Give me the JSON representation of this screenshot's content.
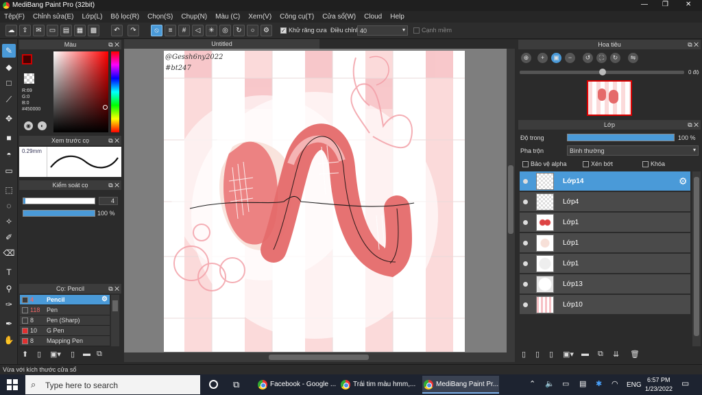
{
  "window": {
    "title": "MediBang Paint Pro (32bit)",
    "min": "—",
    "max": "❐",
    "close": "✕"
  },
  "menu": [
    "Tệp(F)",
    "Chỉnh sửa(E)",
    "Lớp(L)",
    "Bộ lọc(R)",
    "Chọn(S)",
    "Chụp(N)",
    "Màu (C)",
    "Xem(V)",
    "Công cụ(T)",
    "Cửa sổ(W)",
    "Cloud",
    "Help"
  ],
  "toolbar": {
    "antialias_label": "Khử răng cưa",
    "adjust_label": "Điều chỉnh",
    "adjust_value": "40",
    "smooth_label": "Cạnh mềm"
  },
  "color_panel": {
    "title": "Màu",
    "r": "R:69",
    "g": "G:0",
    "b": "B:0",
    "hex": "#450000",
    "primary_color": "#450000"
  },
  "brush_preview": {
    "title": "Xem trước cọ",
    "size": "0.29mm"
  },
  "brush_control": {
    "title": "Kiểm soát cọ",
    "size_value": "4",
    "opacity_value": "100 %"
  },
  "brush_panel": {
    "title": "Cọ: Pencil",
    "items": [
      {
        "size": "4",
        "name": "Pencil",
        "swatch": "#3b3b3b",
        "selected": true
      },
      {
        "size": "118",
        "name": "Pen",
        "swatch": "#3b3b3b",
        "selected": false
      },
      {
        "size": "8",
        "name": "Pen (Sharp)",
        "swatch": "#3b3b3b",
        "selected": false
      },
      {
        "size": "10",
        "name": "G Pen",
        "swatch": "#e03030",
        "selected": false
      },
      {
        "size": "8",
        "name": "Mapping Pen",
        "swatch": "#e03030",
        "selected": false
      }
    ]
  },
  "canvas": {
    "tab_title": "Untitled",
    "signature": "@Gessh6ny2022",
    "hashtag": "#bt247"
  },
  "navigator": {
    "title": "Hoa tiêu",
    "rotation": "0 độ"
  },
  "layers_panel": {
    "title": "Lớp",
    "opacity_label": "Độ trong",
    "opacity_value": "100 %",
    "blend_label": "Pha trộn",
    "blend_value": "Bình thường",
    "protect_alpha": "Bảo vệ alpha",
    "clipping": "Xén bớt",
    "lock": "Khóa",
    "layers": [
      {
        "name": "Lớp14",
        "selected": true
      },
      {
        "name": "Lớp4",
        "selected": false
      },
      {
        "name": "Lớp1",
        "selected": false
      },
      {
        "name": "Lớp1",
        "selected": false
      },
      {
        "name": "Lớp1",
        "selected": false
      },
      {
        "name": "Lớp13",
        "selected": false
      },
      {
        "name": "Lớp10",
        "selected": false
      }
    ]
  },
  "statusbar": {
    "text": "Vừa với kích thước cửa sổ"
  },
  "taskbar": {
    "search_placeholder": "Type here to search",
    "apps": [
      "Facebook - Google ...",
      "Trái tim màu hmm,...",
      "MediBang Paint Pr..."
    ],
    "lang": "ENG",
    "time": "6:57 PM",
    "date": "1/23/2022"
  }
}
